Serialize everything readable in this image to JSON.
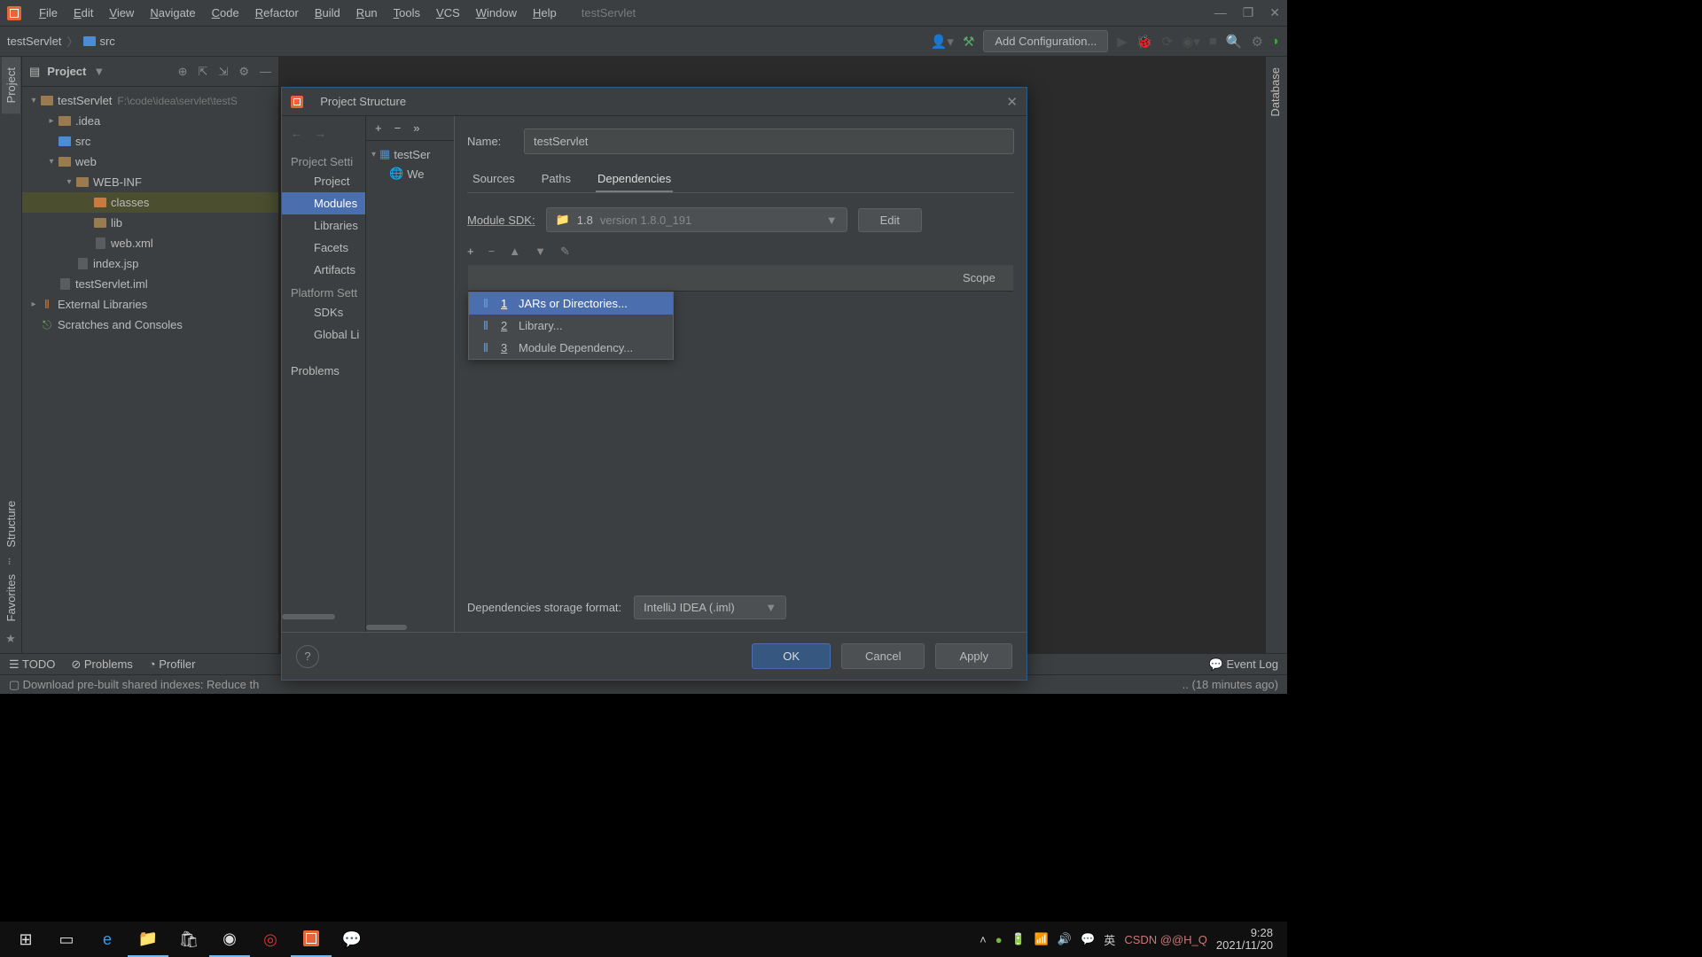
{
  "window": {
    "title": "testServlet"
  },
  "menu": [
    "File",
    "Edit",
    "View",
    "Navigate",
    "Code",
    "Refactor",
    "Build",
    "Run",
    "Tools",
    "VCS",
    "Window",
    "Help"
  ],
  "window_controls": {
    "min": "—",
    "max": "❐",
    "close": "✕"
  },
  "breadcrumb": {
    "project": "testServlet",
    "src": "src"
  },
  "run_config_button": "Add Configuration...",
  "gutter_left": {
    "project": "Project",
    "structure": "Structure",
    "favorites": "Favorites"
  },
  "gutter_right": {
    "database": "Database"
  },
  "project_panel": {
    "title": "Project",
    "tree": [
      {
        "d": 0,
        "exp": "▾",
        "icon": "folder",
        "color": "",
        "label": "testServlet",
        "path": "F:\\code\\idea\\servlet\\testS"
      },
      {
        "d": 1,
        "exp": "▸",
        "icon": "folder",
        "color": "",
        "label": ".idea"
      },
      {
        "d": 1,
        "exp": "",
        "icon": "folder",
        "color": "blue",
        "label": "src"
      },
      {
        "d": 1,
        "exp": "▾",
        "icon": "folder",
        "color": "",
        "label": "web"
      },
      {
        "d": 2,
        "exp": "▾",
        "icon": "folder",
        "color": "",
        "label": "WEB-INF"
      },
      {
        "d": 3,
        "exp": "",
        "icon": "folder",
        "color": "orange",
        "label": "classes",
        "selected": true
      },
      {
        "d": 3,
        "exp": "",
        "icon": "folder",
        "color": "",
        "label": "lib"
      },
      {
        "d": 3,
        "exp": "",
        "icon": "file",
        "label": "web.xml"
      },
      {
        "d": 2,
        "exp": "",
        "icon": "file",
        "label": "index.jsp"
      },
      {
        "d": 1,
        "exp": "",
        "icon": "file",
        "label": "testServlet.iml"
      },
      {
        "d": 0,
        "exp": "▸",
        "icon": "lib",
        "label": "External Libraries"
      },
      {
        "d": 0,
        "exp": "",
        "icon": "scratch",
        "label": "Scratches and Consoles"
      }
    ]
  },
  "statusbar": {
    "todo": "TODO",
    "problems": "Problems",
    "profiler": "Profiler",
    "eventlog": "Event Log"
  },
  "bottom_msg": {
    "left": "Download pre-built shared indexes: Reduce th",
    "right": ".. (18 minutes ago)"
  },
  "dialog": {
    "title": "Project Structure",
    "left_sections": {
      "project_settings": "Project Setti",
      "project": "Project",
      "modules": "Modules",
      "libraries": "Libraries",
      "facets": "Facets",
      "artifacts": "Artifacts",
      "platform_settings": "Platform Sett",
      "sdks": "SDKs",
      "global": "Global Li",
      "problems": "Problems"
    },
    "mid": {
      "toolbar": {
        "add": "+",
        "remove": "−",
        "more": "»"
      },
      "module": "testSer",
      "sub": "We"
    },
    "name_label": "Name:",
    "name_value": "testServlet",
    "tabs": {
      "sources": "Sources",
      "paths": "Paths",
      "dependencies": "Dependencies"
    },
    "sdk_label": "Module SDK:",
    "sdk_value": "1.8",
    "sdk_version": "version 1.8.0_191",
    "edit": "Edit",
    "dep_tools": {
      "add": "+",
      "remove": "−",
      "up": "▲",
      "down": "▼",
      "edit": "✎"
    },
    "dep_header": {
      "export": "",
      "scope": "Scope"
    },
    "popup": [
      {
        "n": "1",
        "label": "JARs or Directories...",
        "hl": true
      },
      {
        "n": "2",
        "label": "Library..."
      },
      {
        "n": "3",
        "label": "Module Dependency..."
      }
    ],
    "storage_label": "Dependencies storage format:",
    "storage_value": "IntelliJ IDEA (.iml)",
    "buttons": {
      "ok": "OK",
      "cancel": "Cancel",
      "apply": "Apply"
    }
  },
  "taskbar": {
    "tray_lang": "英",
    "watermark": "CSDN @@H_Q",
    "time": "9:28",
    "date": "2021/11/20"
  }
}
